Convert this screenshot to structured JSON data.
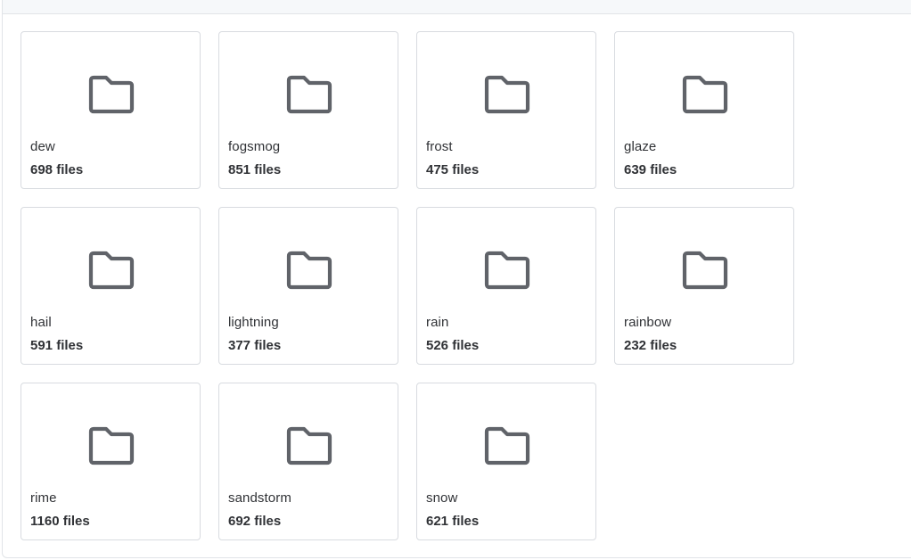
{
  "folders": [
    {
      "name": "dew",
      "count": "698 files"
    },
    {
      "name": "fogsmog",
      "count": "851 files"
    },
    {
      "name": "frost",
      "count": "475 files"
    },
    {
      "name": "glaze",
      "count": "639 files"
    },
    {
      "name": "hail",
      "count": "591 files"
    },
    {
      "name": "lightning",
      "count": "377 files"
    },
    {
      "name": "rain",
      "count": "526 files"
    },
    {
      "name": "rainbow",
      "count": "232 files"
    },
    {
      "name": "rime",
      "count": "1160 files"
    },
    {
      "name": "sandstorm",
      "count": "692 files"
    },
    {
      "name": "snow",
      "count": "621 files"
    }
  ],
  "icon": "folder-icon",
  "colors": {
    "icon": "#606369",
    "border": "#d8dbe0",
    "text": "#303236",
    "header_bg": "#f6f8fa"
  }
}
